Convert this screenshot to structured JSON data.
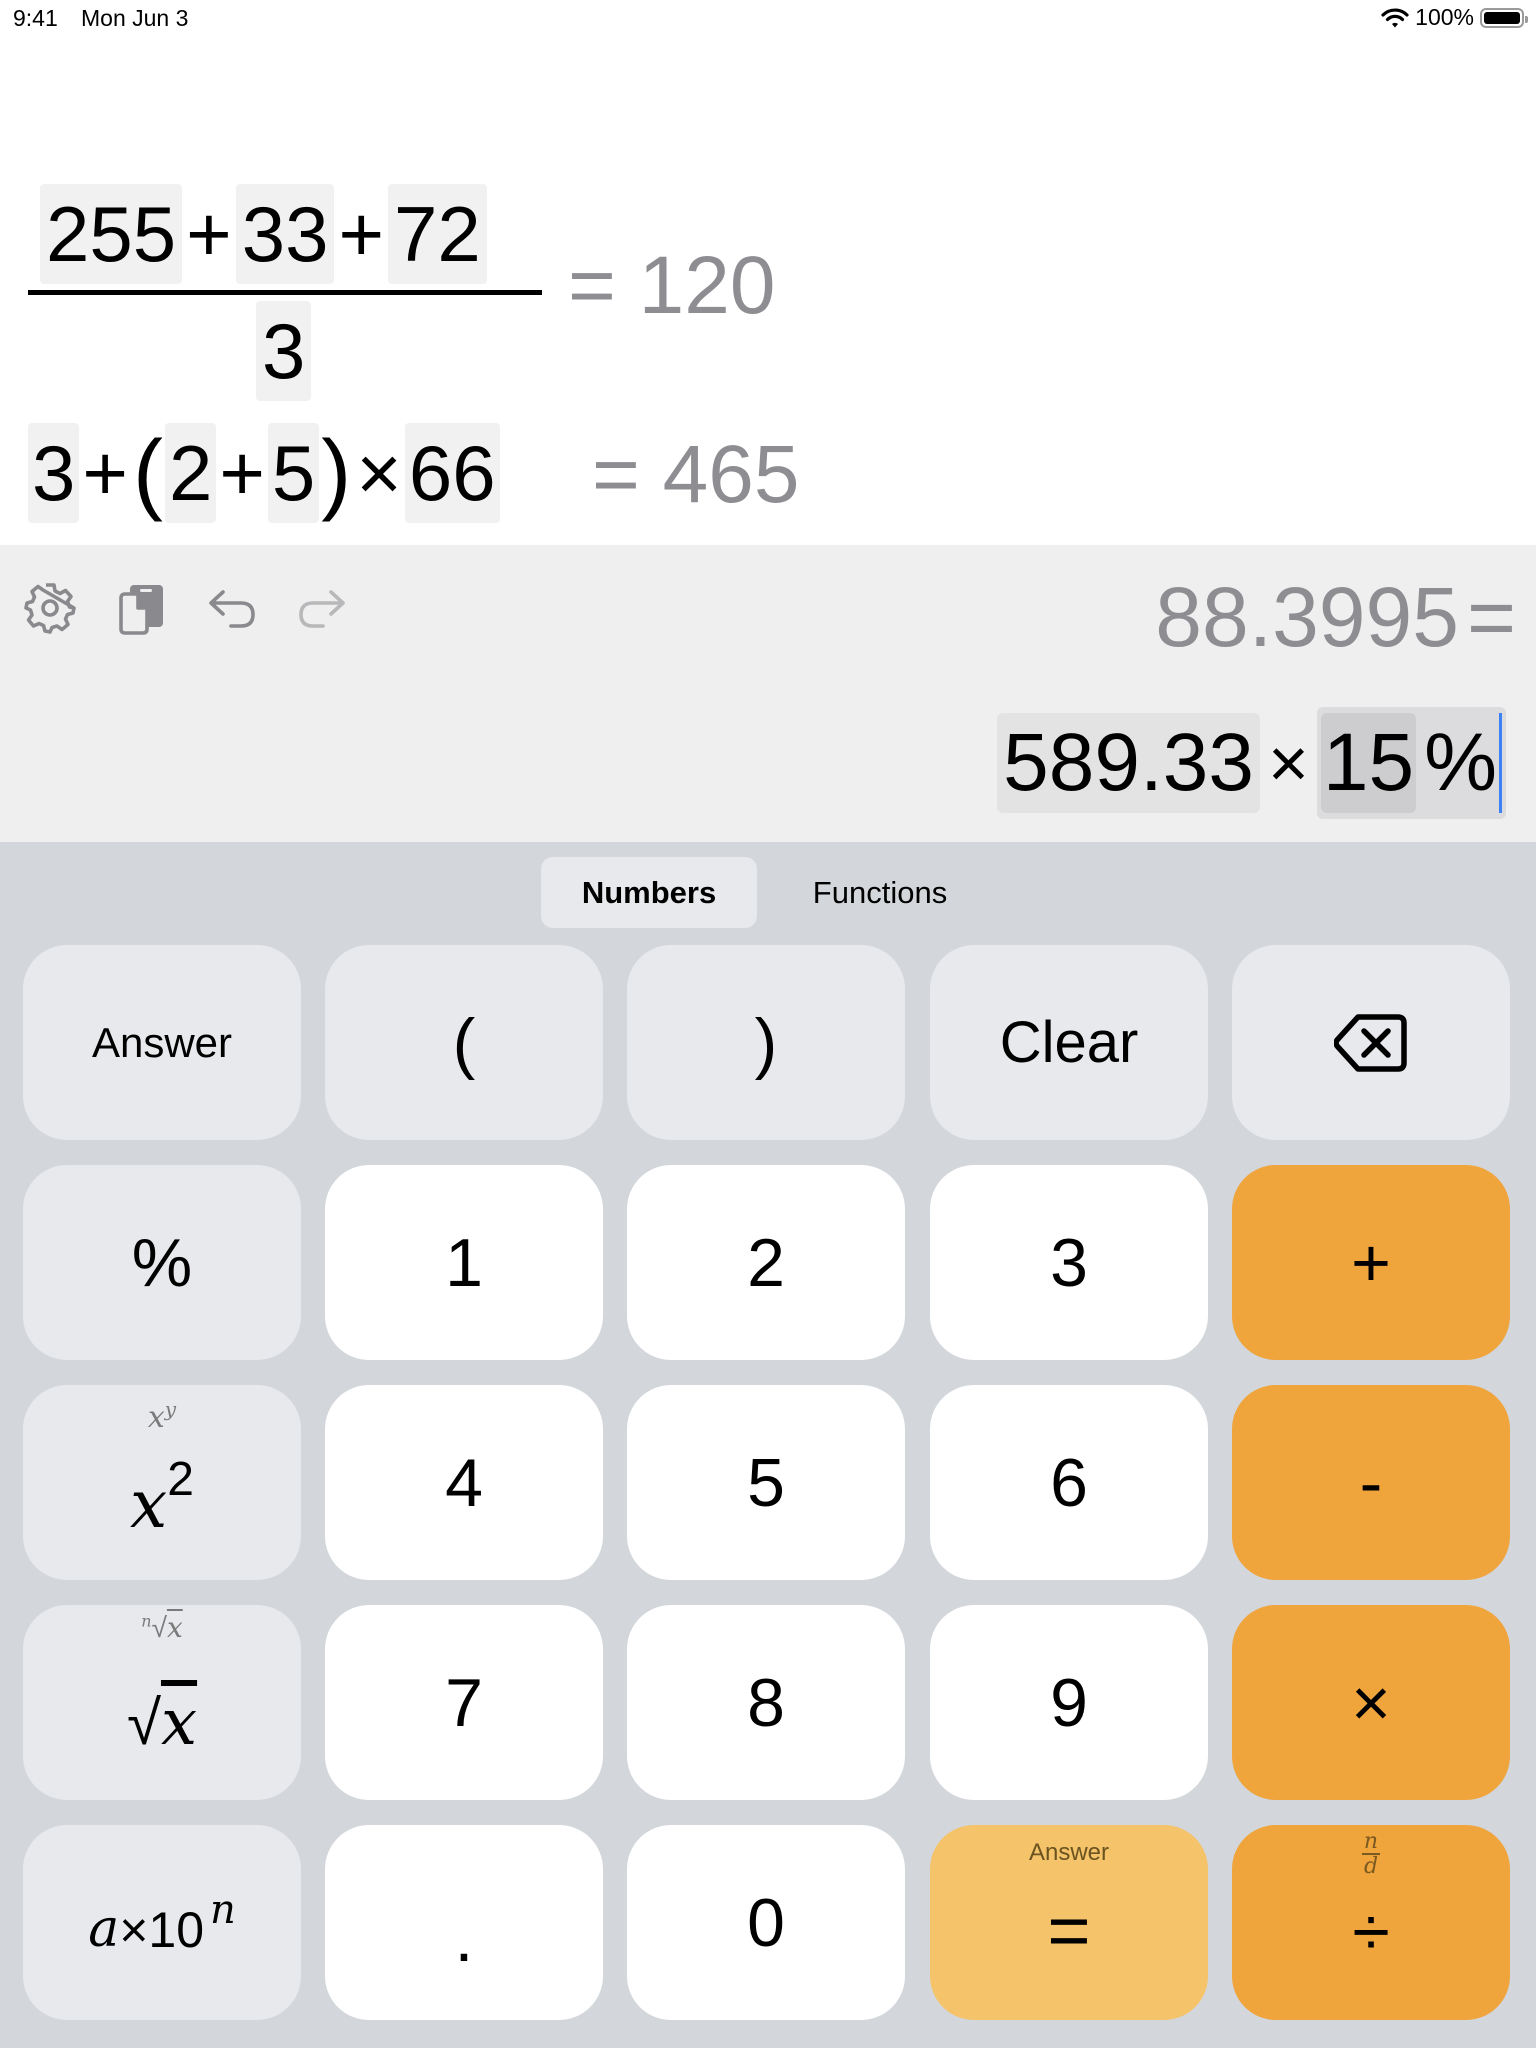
{
  "status_bar": {
    "time": "9:41",
    "date": "Mon Jun 3",
    "battery_text": "100%",
    "battery_level_percent": 100,
    "wifi_icon": "wifi-icon",
    "battery_icon": "battery-icon"
  },
  "history": [
    {
      "type": "fraction",
      "numerator_tokens": [
        "255",
        "+",
        "33",
        "+",
        "72"
      ],
      "denominator": "3",
      "result": "= 120"
    },
    {
      "type": "inline",
      "tokens": [
        "3",
        "+",
        "(",
        "2",
        "+",
        "5",
        ")",
        "×",
        "66"
      ],
      "result": "= 465"
    }
  ],
  "toolbar": {
    "settings_icon": "gear-icon",
    "copy_icon": "copy-icon",
    "undo_icon": "undo-icon",
    "redo_icon": "redo-icon"
  },
  "input": {
    "previous_result": "88.3995",
    "previous_equals": "=",
    "operand1": "589.33",
    "operator": "×",
    "operand2": "15",
    "percent": "%"
  },
  "tabs": {
    "numbers": "Numbers",
    "functions": "Functions",
    "active": "Numbers"
  },
  "keys": {
    "answer": "Answer",
    "open_paren": "(",
    "close_paren": ")",
    "clear": "Clear",
    "backspace_icon": "backspace-icon",
    "percent": "%",
    "one": "1",
    "two": "2",
    "three": "3",
    "plus": "+",
    "square_base": "x",
    "square_exp": "2",
    "power_hint_base": "x",
    "power_hint_exp": "y",
    "four": "4",
    "five": "5",
    "six": "6",
    "minus": "-",
    "sqrt_symbol": "√",
    "sqrt_var": "x",
    "nroot_hint_index": "n",
    "nroot_hint_symbol": "√",
    "nroot_hint_var": "x",
    "seven": "7",
    "eight": "8",
    "nine": "9",
    "multiply": "×",
    "sci_a": "a",
    "sci_times": "×10",
    "sci_exp": "n",
    "decimal": ".",
    "zero": "0",
    "equals": "=",
    "equals_hint": "Answer",
    "divide": "÷",
    "fraction_hint_num": "n",
    "fraction_hint_den": "d"
  },
  "colors": {
    "operator_orange": "#f0a43c",
    "equals_orange": "#f4c36a",
    "caret_blue": "#3b82f6",
    "result_gray": "#8e8e92"
  }
}
